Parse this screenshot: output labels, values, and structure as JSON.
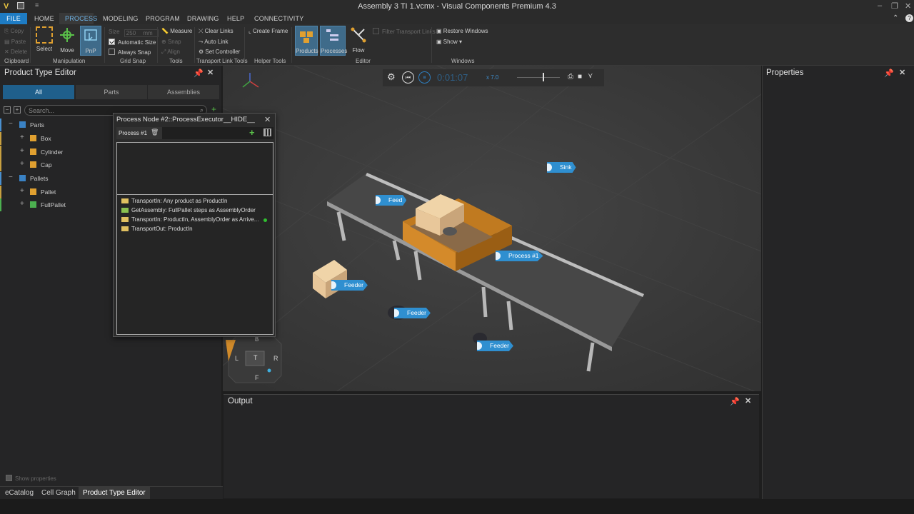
{
  "window": {
    "title": "Assembly 3 TI 1.vcmx - Visual Components Premium 4.3"
  },
  "menu": {
    "tabs": [
      "FILE",
      "HOME",
      "PROCESS",
      "MODELING",
      "PROGRAM",
      "DRAWING",
      "HELP",
      "CONNECTIVITY"
    ],
    "active": "PROCESS"
  },
  "ribbon": {
    "clipboard": {
      "copy": "Copy",
      "paste": "Paste",
      "delete": "Delete",
      "group": "Clipboard"
    },
    "manipulation": {
      "select": "Select",
      "move": "Move",
      "pnp": "PnP",
      "group": "Manipulation"
    },
    "grid_snap": {
      "size_label": "Size",
      "size_value": "250",
      "size_unit": "mm",
      "automatic_size": "Automatic Size",
      "always_snap": "Always Snap",
      "group": "Grid Snap",
      "automatic_size_checked": true,
      "always_snap_checked": false
    },
    "tools": {
      "measure": "Measure",
      "snap": "Snap",
      "align": "Align",
      "group": "Tools"
    },
    "transport_link": {
      "clear_links": "Clear Links",
      "auto_link": "Auto Link",
      "set_controller": "Set Controller",
      "group": "Transport Link Tools"
    },
    "helper": {
      "create_frame": "Create Frame",
      "group": "Helper Tools"
    },
    "editor": {
      "products": "Products",
      "processes": "Processes",
      "flow": "Flow",
      "filter_transport_links": "Filter Transport Links",
      "group": "Editor"
    },
    "windows": {
      "restore_windows": "Restore Windows",
      "show": "Show ▾",
      "group": "Windows"
    }
  },
  "product_type_editor": {
    "title": "Product Type Editor",
    "tabs": [
      "All",
      "Parts",
      "Assemblies"
    ],
    "active_tab": "All",
    "search_placeholder": "Search...",
    "tree": [
      {
        "label": "Parts",
        "level": 0,
        "kind": "folder",
        "expander": "−"
      },
      {
        "label": "Box",
        "level": 1,
        "kind": "part",
        "expander": "+"
      },
      {
        "label": "Cylinder",
        "level": 1,
        "kind": "part",
        "expander": "+"
      },
      {
        "label": "Cap",
        "level": 1,
        "kind": "part",
        "expander": "+"
      },
      {
        "label": "Pallets",
        "level": 0,
        "kind": "folder",
        "expander": "−"
      },
      {
        "label": "Pallet",
        "level": 1,
        "kind": "part",
        "expander": "+"
      },
      {
        "label": "FullPallet",
        "level": 1,
        "kind": "assembly",
        "expander": "+"
      }
    ],
    "show_properties": "Show properties"
  },
  "process_dialog": {
    "title": "Process Node #2::ProcessExecutor__HIDE__",
    "tab": "Process #1",
    "statements": [
      "TransportIn: Any product as ProductIn",
      "GetAssembly: FullPallet steps as AssemblyOrder",
      "TransportIn: ProductIn, AssemblyOrder as Arrive...",
      "TransportOut: ProductIn"
    ]
  },
  "playback": {
    "time": "0:01:07",
    "speed": "x 7.0"
  },
  "viewport_labels": [
    "Sink",
    "Feed",
    "Process #1",
    "Feeder",
    "Feeder",
    "Feeder"
  ],
  "nav_cube": {
    "top": "T",
    "left": "L",
    "right": "R",
    "front": "F",
    "back": "B"
  },
  "output_panel": {
    "title": "Output"
  },
  "properties_panel": {
    "title": "Properties"
  },
  "bottom_tabs": [
    "eCatalog",
    "Cell Graph",
    "Product Type Editor"
  ],
  "active_bottom_tab": "Product Type Editor",
  "colors": {
    "accent": "#1e7cc4",
    "label_blue": "#2f8fd0",
    "panel": "#252526"
  }
}
